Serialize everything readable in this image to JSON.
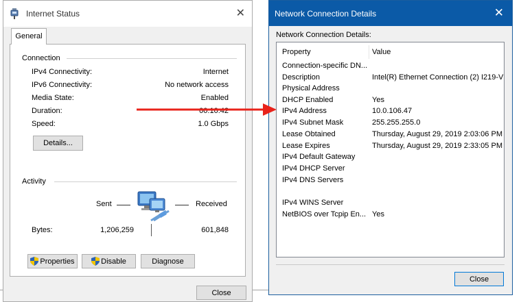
{
  "status_window": {
    "title": "Internet Status",
    "tab_label": "General",
    "connection": {
      "group_title": "Connection",
      "rows": [
        {
          "label": "IPv4 Connectivity:",
          "value": "Internet"
        },
        {
          "label": "IPv6 Connectivity:",
          "value": "No network access"
        },
        {
          "label": "Media State:",
          "value": "Enabled"
        },
        {
          "label": "Duration:",
          "value": "00:10:42"
        },
        {
          "label": "Speed:",
          "value": "1.0 Gbps"
        }
      ],
      "details_button": "Details..."
    },
    "activity": {
      "group_title": "Activity",
      "sent_label": "Sent",
      "received_label": "Received",
      "bytes_label": "Bytes:",
      "bytes_sent": "1,206,259",
      "bytes_received": "601,848"
    },
    "buttons": {
      "properties": "Properties",
      "disable": "Disable",
      "diagnose": "Diagnose",
      "close": "Close"
    }
  },
  "details_window": {
    "title": "Network Connection Details",
    "subtitle": "Network Connection Details:",
    "columns": {
      "property": "Property",
      "value": "Value"
    },
    "rows": [
      {
        "property": "Connection-specific DN...",
        "value": ""
      },
      {
        "property": "Description",
        "value": "Intel(R) Ethernet Connection (2) I219-V"
      },
      {
        "property": "Physical Address",
        "value": ""
      },
      {
        "property": "DHCP Enabled",
        "value": "Yes"
      },
      {
        "property": "IPv4 Address",
        "value": "10.0.106.47"
      },
      {
        "property": "IPv4 Subnet Mask",
        "value": "255.255.255.0"
      },
      {
        "property": "Lease Obtained",
        "value": "Thursday, August 29, 2019 2:03:06 PM"
      },
      {
        "property": "Lease Expires",
        "value": "Thursday, August 29, 2019 2:33:05 PM"
      },
      {
        "property": "IPv4 Default Gateway",
        "value": ""
      },
      {
        "property": "IPv4 DHCP Server",
        "value": ""
      },
      {
        "property": "IPv4 DNS Servers",
        "value": ""
      },
      {
        "property": "",
        "value": ""
      },
      {
        "property": "IPv4 WINS Server",
        "value": ""
      },
      {
        "property": "NetBIOS over Tcpip En...",
        "value": "Yes"
      }
    ],
    "close_button": "Close"
  },
  "colors": {
    "arrow": "#e8231b",
    "titlebar_active": "#0b5aa7",
    "button_face": "#e1e1e1"
  },
  "icons": {
    "status_title_icon": "network-adapter-icon",
    "activity_icon": "network-computers-icon",
    "shield": "uac-shield-icon",
    "close": "close-icon",
    "arrow": "right-arrow-icon"
  }
}
